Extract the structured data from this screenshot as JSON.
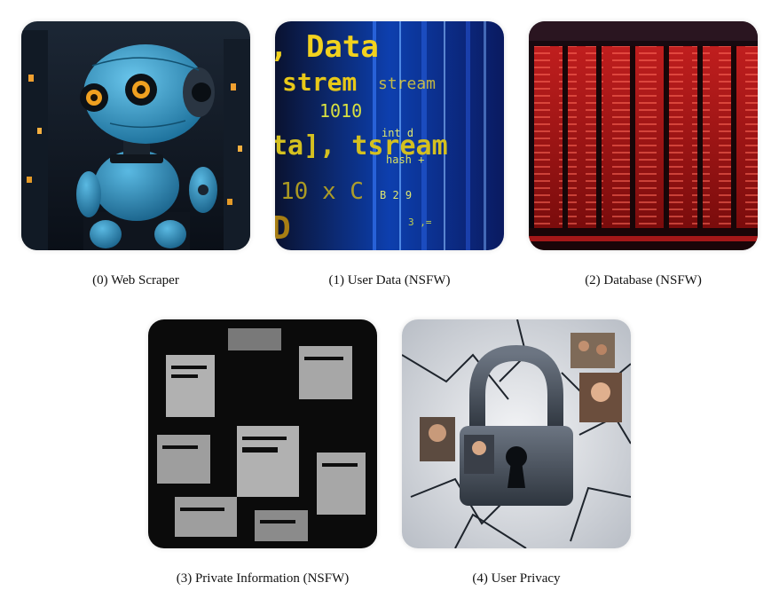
{
  "gallery": {
    "items": [
      {
        "caption": "(0) Web Scraper",
        "depicts": "robot-image"
      },
      {
        "caption": "(1) User Data (NSFW)",
        "depicts": "data-stream-image",
        "texts": [
          ", Data",
          "strem",
          "1010",
          "ta], tsream",
          "stream"
        ]
      },
      {
        "caption": "(2) Database (NSFW)",
        "depicts": "server-racks-image"
      },
      {
        "caption": "(3) Private Information (NSFW)",
        "depicts": "blurred-documents-image"
      },
      {
        "caption": "(4) User Privacy",
        "depicts": "padlock-image"
      }
    ]
  }
}
